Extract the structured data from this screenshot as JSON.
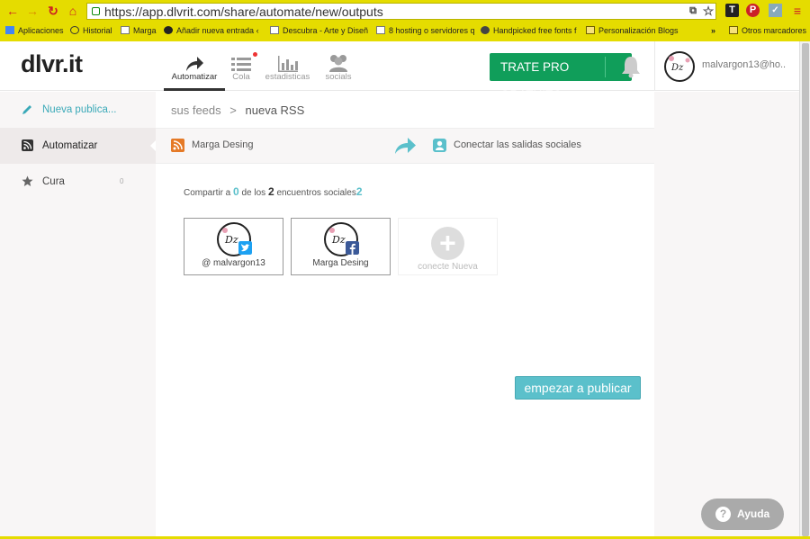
{
  "browser": {
    "url": "https://app.dlvrit.com/share/automate/new/outputs",
    "bookmarks": [
      "Aplicaciones",
      "Historial",
      "Marga",
      "Añadir nueva entrada ‹",
      "Descubra - Arte y Diseñ",
      "8 hosting o servidores q",
      "Handpicked free fonts f",
      "Personalización Blogs"
    ],
    "bookmarks_more": "»",
    "other_bookmarks": "Otros marcadores"
  },
  "app": {
    "logo": "dlvr.it",
    "nav": {
      "automatizar": "Automatizar",
      "cola": "Cola",
      "estadisticas": "estadisticas",
      "sociales": "socials"
    },
    "trial_button": "TRATE PRO GRATUITO",
    "user_name": "malvargon13@ho..",
    "sidebar": {
      "new_post": "Nueva publica...",
      "automate": "Automatizar",
      "curate": "Cura",
      "curate_count": "0"
    },
    "breadcrumb": {
      "root": "sus feeds",
      "separator": ">",
      "current": "nueva RSS"
    },
    "steps": {
      "feed_name": "Marga Desing",
      "connect_label": "Conectar las salidas sociales"
    },
    "share_line": {
      "prefix": "Compartir a",
      "shared": "0",
      "middle": "de los",
      "total": "2",
      "suffix": "encuentros sociales",
      "total_again": "2"
    },
    "cards": [
      {
        "label": "@ malvargon13",
        "network": "twitter"
      },
      {
        "label": "Marga Desing",
        "network": "facebook"
      }
    ],
    "connect_new": "conecte Nueva",
    "start_button": "empezar a publicar",
    "help_button": "Ayuda"
  },
  "colors": {
    "accent": "#5bc0cb",
    "trial_green": "#109e5a",
    "browser_bar": "#e5dc00",
    "rss_orange": "#e57a27",
    "twitter": "#1da1f2",
    "facebook": "#3b5998"
  }
}
